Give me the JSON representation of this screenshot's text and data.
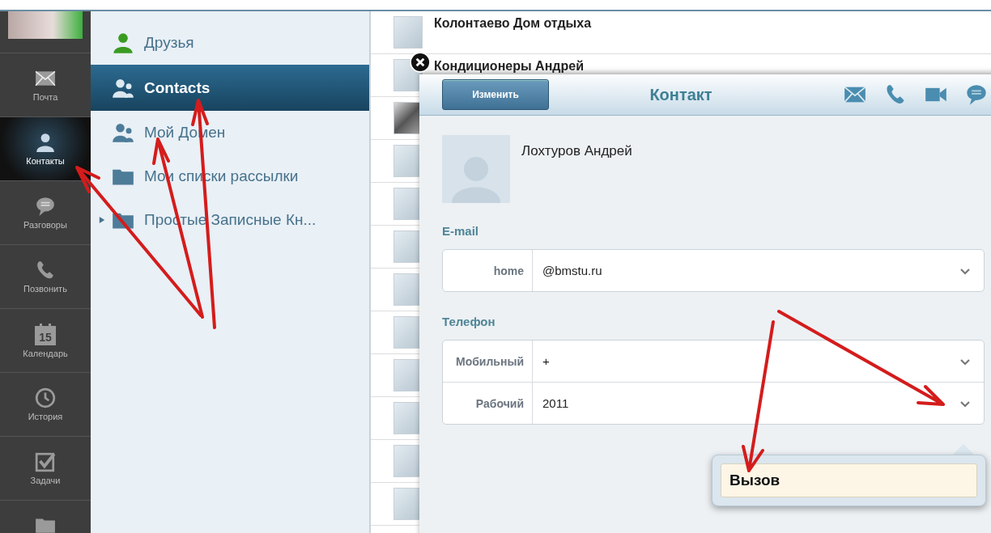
{
  "nav": {
    "items": [
      {
        "kind": "photo",
        "selected": false
      },
      {
        "kind": "mail",
        "label": "Почта",
        "selected": false
      },
      {
        "kind": "person",
        "label": "Контакты",
        "selected": true
      },
      {
        "kind": "chat",
        "label": "Разговоры",
        "selected": false
      },
      {
        "kind": "phone",
        "label": "Позвонить",
        "selected": false
      },
      {
        "kind": "calendar",
        "label": "Календарь",
        "badge": "15",
        "selected": false
      },
      {
        "kind": "clock",
        "label": "История",
        "selected": false
      },
      {
        "kind": "check",
        "label": "Задачи",
        "selected": false
      },
      {
        "kind": "folder",
        "selected": false
      }
    ]
  },
  "folders": {
    "items": [
      {
        "kind": "person",
        "label": "Друзья",
        "selected": false,
        "expandable": false
      },
      {
        "kind": "group",
        "label": "Contacts",
        "selected": true,
        "expandable": false
      },
      {
        "kind": "group",
        "label": "Мой Домен",
        "selected": false,
        "expandable": false
      },
      {
        "kind": "folder",
        "label": "Мои списки рассылки",
        "selected": false,
        "expandable": false
      },
      {
        "kind": "folder",
        "label": "Простые Записные Кн...",
        "selected": false,
        "expandable": true
      }
    ]
  },
  "contacts": [
    {
      "name": "Колонтаево Дом отдыха",
      "kind": "blank"
    },
    {
      "name": "Кондиционеры Андрей",
      "kind": "blank"
    },
    {
      "kind": "photo"
    },
    {
      "kind": "blank"
    },
    {
      "kind": "blank"
    },
    {
      "kind": "blank"
    },
    {
      "kind": "blank"
    },
    {
      "kind": "blank"
    },
    {
      "kind": "blank"
    },
    {
      "kind": "blank"
    },
    {
      "kind": "blank"
    },
    {
      "kind": "blank"
    }
  ],
  "panel": {
    "edit_button": "Изменить",
    "title": "Контакт",
    "actions": [
      {
        "kind": "mail"
      },
      {
        "kind": "phone"
      },
      {
        "kind": "video"
      },
      {
        "kind": "chat"
      }
    ],
    "name": "Лохтуров Андрей",
    "sections": [
      {
        "heading": "E-mail",
        "rows": [
          {
            "label": "home",
            "value": "@bmstu.ru"
          }
        ]
      },
      {
        "heading": "Телефон",
        "rows": [
          {
            "label": "Мобильный",
            "value": "+"
          },
          {
            "label": "Рабочий",
            "value": "2011"
          }
        ]
      }
    ],
    "popup": {
      "items": [
        "Вызов"
      ]
    }
  }
}
